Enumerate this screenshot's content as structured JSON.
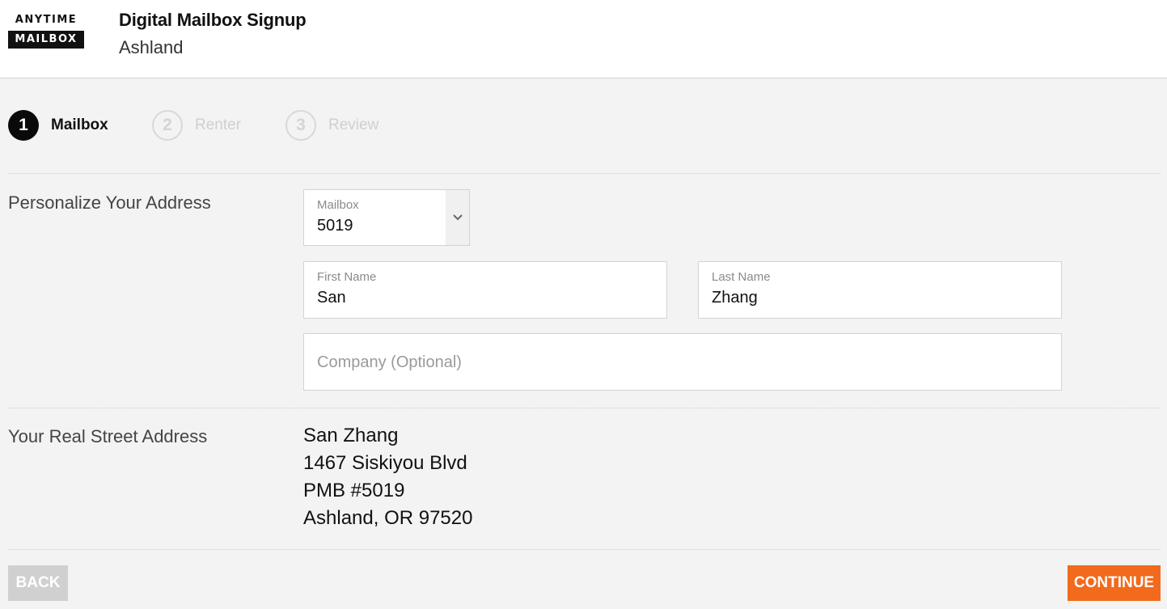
{
  "header": {
    "logo_top": "ANYTIME",
    "logo_bottom": "MAILBOX",
    "title": "Digital Mailbox Signup",
    "subtitle": "Ashland"
  },
  "steps": [
    {
      "number": "1",
      "label": "Mailbox",
      "state": "active"
    },
    {
      "number": "2",
      "label": "Renter",
      "state": "inactive"
    },
    {
      "number": "3",
      "label": "Review",
      "state": "inactive"
    }
  ],
  "personalize": {
    "section_label": "Personalize Your Address",
    "mailbox": {
      "label": "Mailbox",
      "value": "5019"
    },
    "first_name": {
      "label": "First Name",
      "value": "San"
    },
    "last_name": {
      "label": "Last Name",
      "value": "Zhang"
    },
    "company": {
      "placeholder": "Company (Optional)"
    }
  },
  "street_address": {
    "section_label": "Your Real Street Address",
    "lines": [
      "San Zhang",
      "1467 Siskiyou Blvd",
      "PMB #5019",
      "Ashland, OR 97520"
    ]
  },
  "buttons": {
    "back": "BACK",
    "continue": "CONTINUE"
  },
  "colors": {
    "accent": "#f26a1b",
    "background": "#f3f3f3",
    "active_step": "#0a0a0a",
    "inactive_step": "#d4d4d4"
  }
}
